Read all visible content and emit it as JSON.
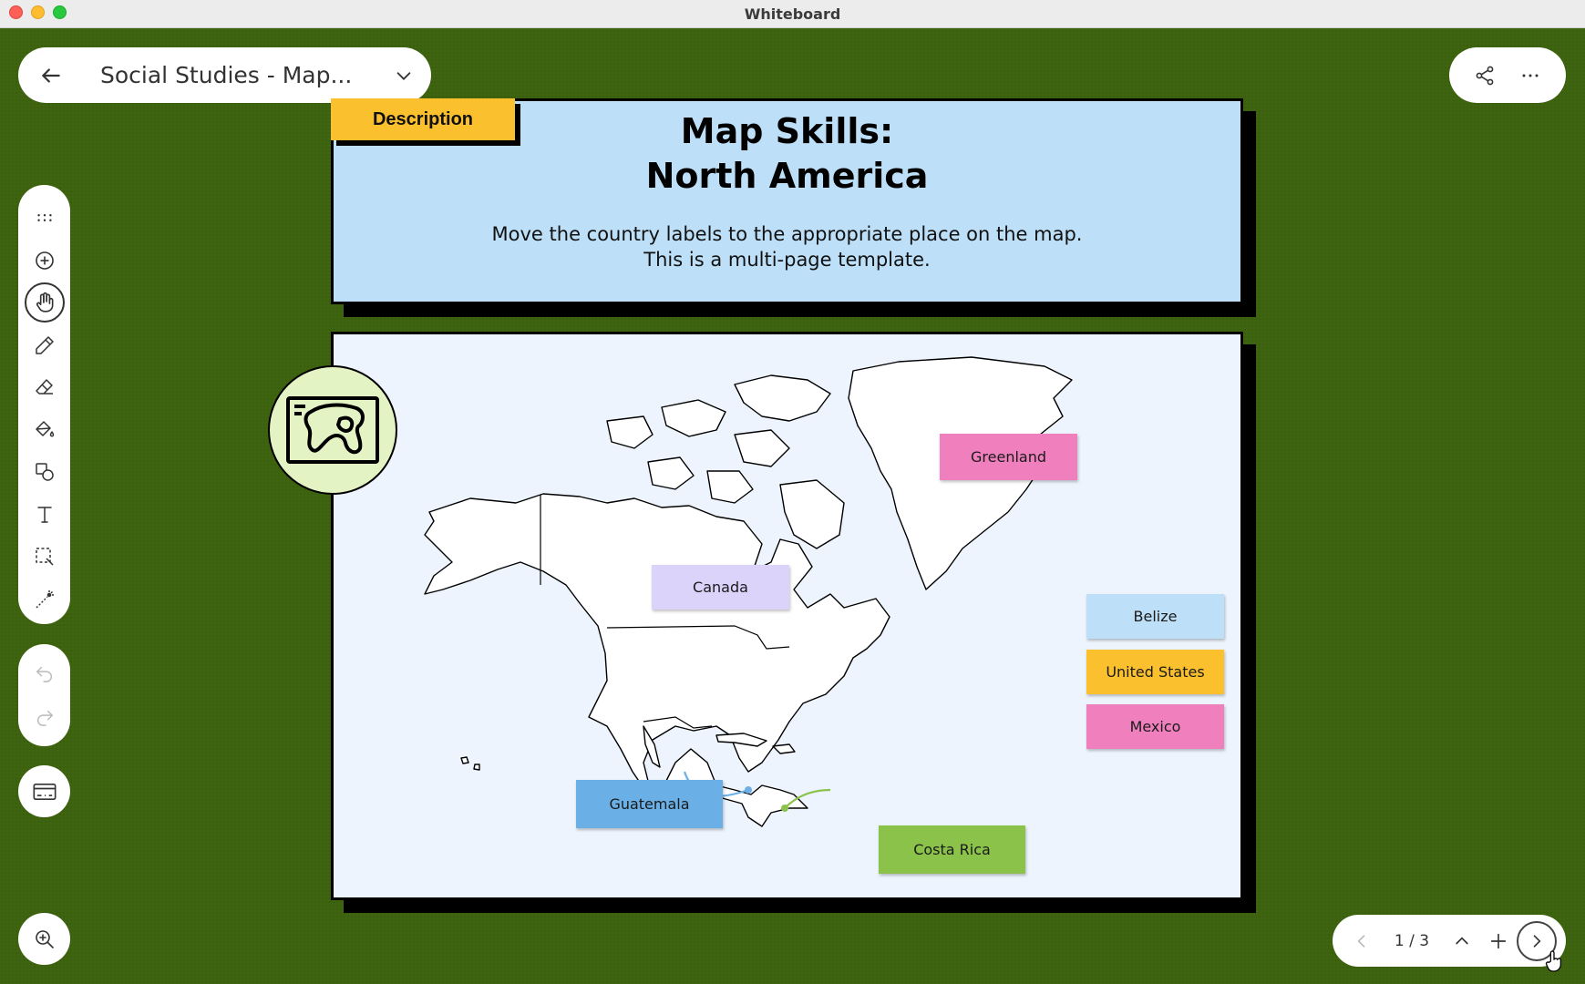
{
  "window": {
    "title": "Whiteboard"
  },
  "header": {
    "board_name": "Social Studies - Map..."
  },
  "description_card": {
    "tab_label": "Description",
    "title_line1": "Map Skills:",
    "title_line2": "North America",
    "text_line1": "Move the country labels to the appropriate place on the map.",
    "text_line2": "This is a multi-page template."
  },
  "map": {
    "labels": [
      {
        "text": "Greenland",
        "color": "#f07fbe"
      },
      {
        "text": "Canada",
        "color": "#dcd3fb"
      },
      {
        "text": "Belize",
        "color": "#bde0f8"
      },
      {
        "text": "United States",
        "color": "#fbc02d"
      },
      {
        "text": "Mexico",
        "color": "#f07fbe"
      },
      {
        "text": "Guatemala",
        "color": "#6ab0e6"
      },
      {
        "text": "Costa Rica",
        "color": "#8bc34a"
      }
    ]
  },
  "pagination": {
    "indicator": "1 / 3"
  },
  "colors": {
    "canvas": "#3e6410",
    "card_border": "#000000"
  }
}
